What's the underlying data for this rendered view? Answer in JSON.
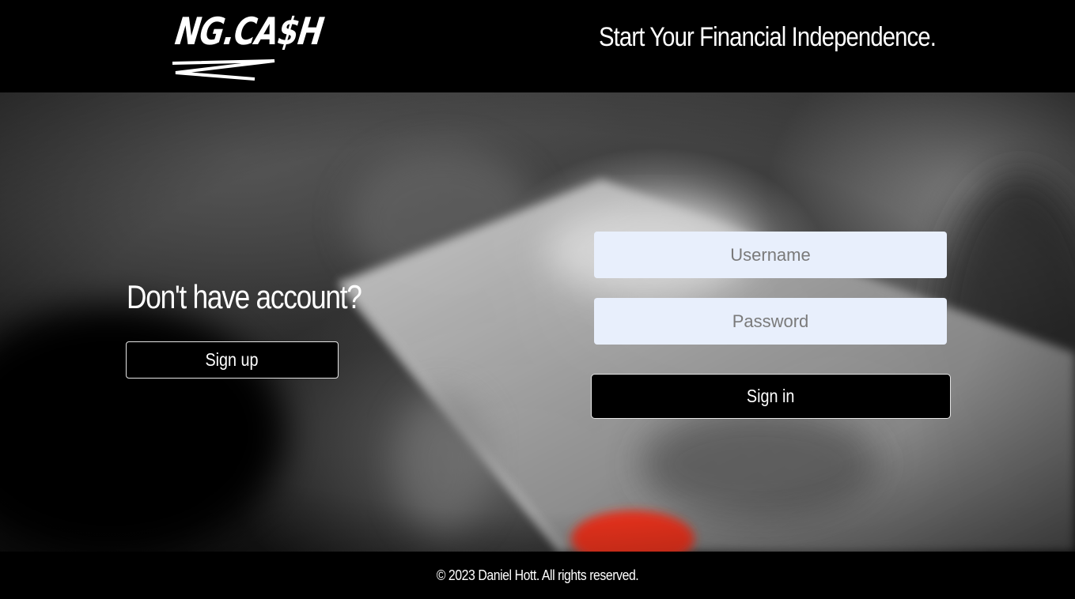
{
  "header": {
    "logo_text": "NG.CA$H",
    "tagline": "Start Your Financial Independence."
  },
  "signup": {
    "title": "Don't have account?",
    "button_label": "Sign up"
  },
  "login": {
    "username_placeholder": "Username",
    "username_value": "",
    "password_placeholder": "Password",
    "password_value": "",
    "button_label": "Sign in"
  },
  "footer": {
    "copyright": "© 2023 Daniel Hott. All rights reserved."
  },
  "colors": {
    "background": "#000000",
    "text": "#ffffff",
    "input_background": "#e8effc",
    "card_accent": "#e8321e"
  },
  "icons": {
    "logo": "ngcash-logo"
  }
}
